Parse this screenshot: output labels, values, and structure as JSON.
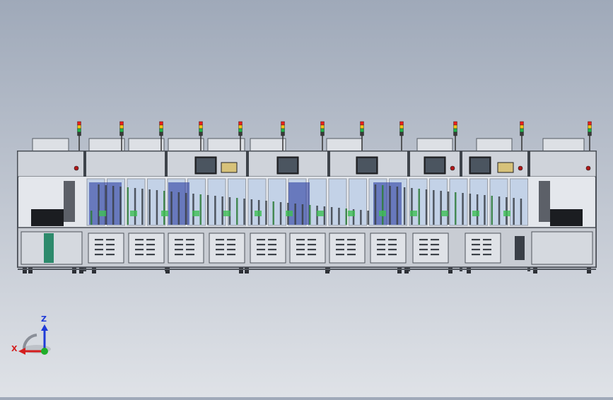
{
  "viewport": {
    "model": "automated-assembly-line",
    "modules": 13,
    "signal_towers": 13,
    "signal_colors": [
      "#e8201c",
      "#f2c418",
      "#22b14c",
      "#3a3a3a"
    ],
    "frame_color": "#4a4f57",
    "panel_color": "#d9dde3",
    "glass_color": "#a9c2e3",
    "accent_blue": "#1d2f9a"
  },
  "triad": {
    "z_label": "Z",
    "x_label": "X",
    "z_color": "#1f3ad8",
    "x_color": "#d41e1e",
    "origin_color": "#1fae2a"
  }
}
